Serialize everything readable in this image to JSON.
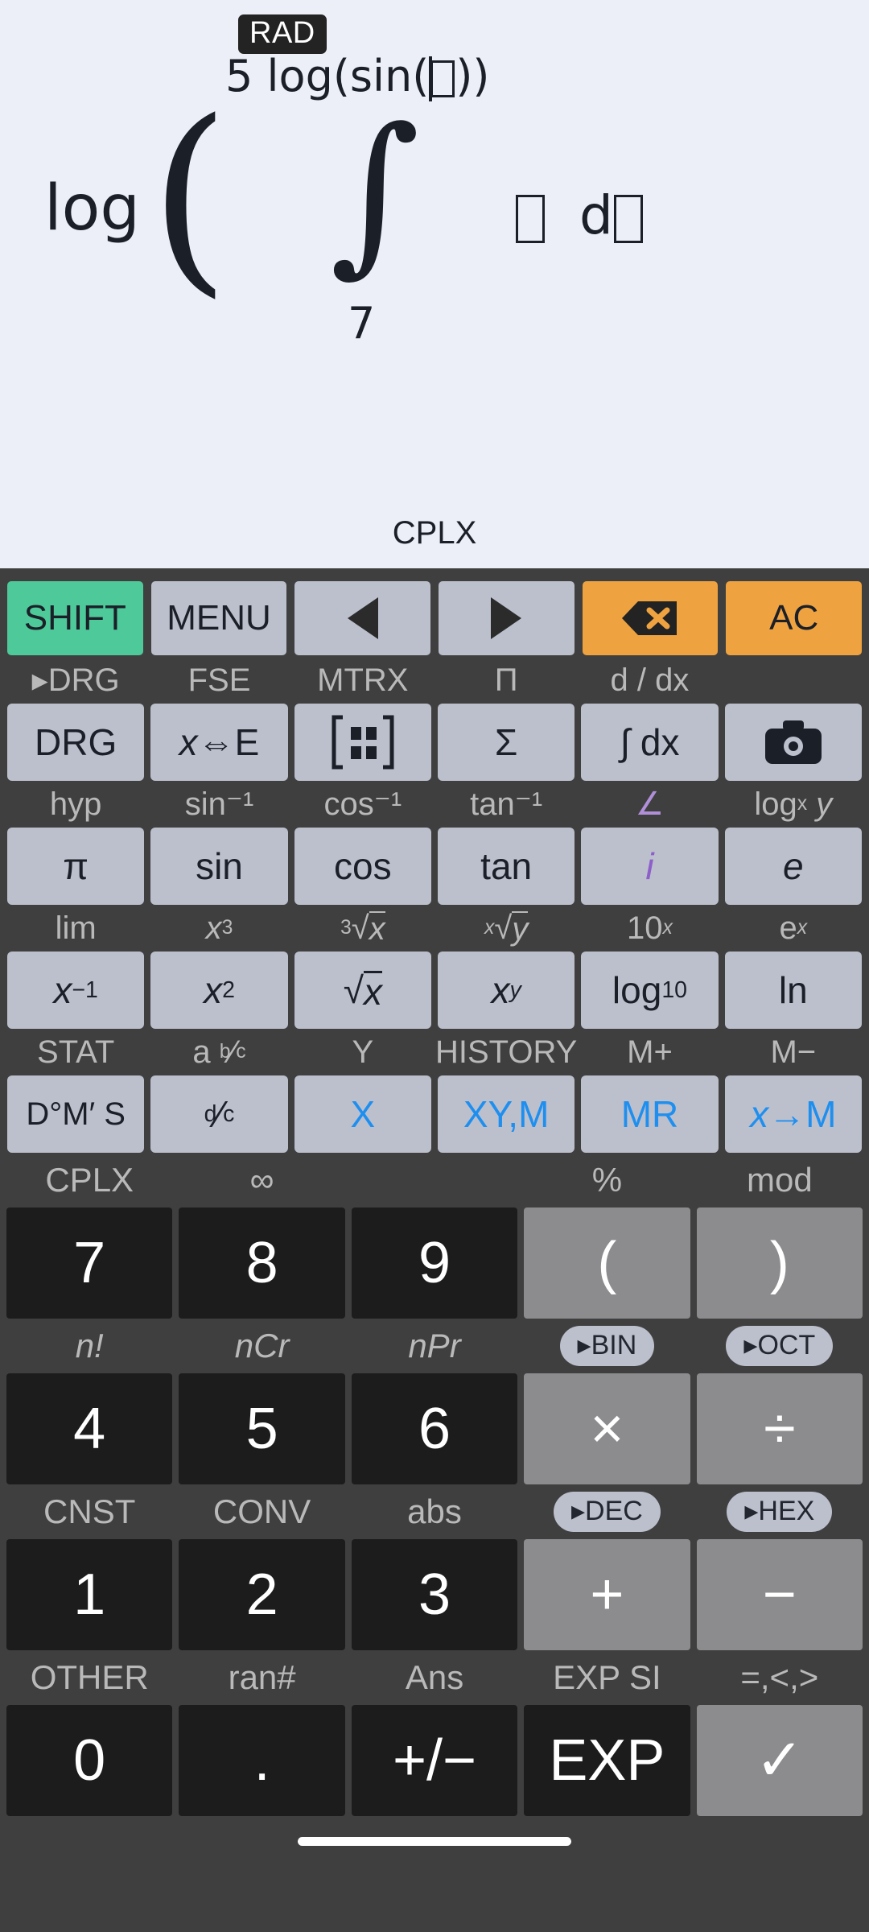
{
  "display": {
    "angle_mode_badge": "RAD",
    "expression": {
      "outer_function": "log",
      "open_paren": "(",
      "integral_upper_limit": "5 log(sin(□))",
      "integral_symbol": "∫",
      "integral_lower_limit": "7",
      "integrand": "□ d□"
    },
    "mode_label": "CPLX"
  },
  "keypad": {
    "control_row": [
      {
        "label": "SHIFT",
        "style": "green",
        "name": "shift-button"
      },
      {
        "label": "MENU",
        "style": "plain",
        "name": "menu-button"
      },
      {
        "label": "◀",
        "style": "plain",
        "name": "cursor-left-button"
      },
      {
        "label": "▶",
        "style": "plain",
        "name": "cursor-right-button"
      },
      {
        "label": "⌫",
        "style": "orange",
        "name": "backspace-button"
      },
      {
        "label": "AC",
        "style": "orange",
        "name": "all-clear-button"
      }
    ],
    "function_rows": [
      {
        "sublabels": [
          "▸DRG",
          "FSE",
          "MTRX",
          "Π",
          "d / dx",
          ""
        ],
        "keys": [
          {
            "label": "DRG",
            "name": "drg-button"
          },
          {
            "label": "x⇔E",
            "name": "x-to-e-button"
          },
          {
            "label": "matrix-icon",
            "name": "matrix-button",
            "icon": "matrix"
          },
          {
            "label": "Σ",
            "name": "sigma-button"
          },
          {
            "label": "∫ dx",
            "name": "integral-dx-button"
          },
          {
            "label": "camera-icon",
            "name": "camera-button",
            "icon": "camera"
          }
        ]
      },
      {
        "sublabels": [
          "hyp",
          "sin⁻¹",
          "cos⁻¹",
          "tan⁻¹",
          "∠",
          "logₓ y"
        ],
        "keys": [
          {
            "label": "π",
            "name": "pi-button"
          },
          {
            "label": "sin",
            "name": "sin-button"
          },
          {
            "label": "cos",
            "name": "cos-button"
          },
          {
            "label": "tan",
            "name": "tan-button"
          },
          {
            "label": "i",
            "name": "imaginary-unit-button",
            "color": "violet"
          },
          {
            "label": "e",
            "name": "euler-e-button"
          }
        ]
      },
      {
        "sublabels": [
          "lim",
          "x³",
          "³√x",
          "ˣ√y",
          "10ˣ",
          "eˣ"
        ],
        "keys": [
          {
            "label": "x⁻¹",
            "name": "reciprocal-button"
          },
          {
            "label": "x²",
            "name": "square-button"
          },
          {
            "label": "√x",
            "name": "square-root-button"
          },
          {
            "label": "xʸ",
            "name": "power-button"
          },
          {
            "label": "log₁₀",
            "name": "log10-button"
          },
          {
            "label": "ln",
            "name": "natural-log-button"
          }
        ]
      },
      {
        "sublabels": [
          "STAT",
          "a b/c",
          "Y",
          "HISTORY",
          "M+",
          "M−"
        ],
        "keys": [
          {
            "label": "D°M′ S",
            "name": "dms-button"
          },
          {
            "label": "d/c",
            "name": "improper-fraction-button"
          },
          {
            "label": "X",
            "name": "variable-x-button",
            "color": "blue"
          },
          {
            "label": "XY,M",
            "name": "xym-button",
            "color": "blue"
          },
          {
            "label": "MR",
            "name": "memory-recall-button",
            "color": "blue"
          },
          {
            "label": "x→M",
            "name": "store-to-memory-button",
            "color": "blue"
          }
        ]
      }
    ],
    "numeric_rows": [
      {
        "sublabels": [
          {
            "text": "CPLX",
            "pill": false
          },
          {
            "text": "∞",
            "pill": false
          },
          {
            "text": "",
            "pill": false
          },
          {
            "text": "%",
            "pill": false
          },
          {
            "text": "mod",
            "pill": false
          }
        ],
        "keys": [
          {
            "label": "7",
            "style": "digit",
            "name": "digit-7-button"
          },
          {
            "label": "8",
            "style": "digit",
            "name": "digit-8-button"
          },
          {
            "label": "9",
            "style": "digit",
            "name": "digit-9-button"
          },
          {
            "label": "(",
            "style": "op",
            "name": "open-paren-button"
          },
          {
            "label": ")",
            "style": "op",
            "name": "close-paren-button"
          }
        ]
      },
      {
        "sublabels": [
          {
            "text": "n!",
            "pill": false
          },
          {
            "text": "nCr",
            "pill": false
          },
          {
            "text": "nPr",
            "pill": false
          },
          {
            "text": "▸BIN",
            "pill": true
          },
          {
            "text": "▸OCT",
            "pill": true
          }
        ],
        "keys": [
          {
            "label": "4",
            "style": "digit",
            "name": "digit-4-button"
          },
          {
            "label": "5",
            "style": "digit",
            "name": "digit-5-button"
          },
          {
            "label": "6",
            "style": "digit",
            "name": "digit-6-button"
          },
          {
            "label": "×",
            "style": "op",
            "name": "multiply-button"
          },
          {
            "label": "÷",
            "style": "op",
            "name": "divide-button"
          }
        ]
      },
      {
        "sublabels": [
          {
            "text": "CNST",
            "pill": false
          },
          {
            "text": "CONV",
            "pill": false
          },
          {
            "text": "abs",
            "pill": false
          },
          {
            "text": "▸DEC",
            "pill": true
          },
          {
            "text": "▸HEX",
            "pill": true
          }
        ],
        "keys": [
          {
            "label": "1",
            "style": "digit",
            "name": "digit-1-button"
          },
          {
            "label": "2",
            "style": "digit",
            "name": "digit-2-button"
          },
          {
            "label": "3",
            "style": "digit",
            "name": "digit-3-button"
          },
          {
            "label": "+",
            "style": "op",
            "name": "plus-button"
          },
          {
            "label": "−",
            "style": "op",
            "name": "minus-button"
          }
        ]
      },
      {
        "sublabels": [
          {
            "text": "OTHER",
            "pill": false
          },
          {
            "text": "ran#",
            "pill": false
          },
          {
            "text": "Ans",
            "pill": false
          },
          {
            "text": "EXP SI",
            "pill": false
          },
          {
            "text": "=,<,>",
            "pill": false
          }
        ],
        "keys": [
          {
            "label": "0",
            "style": "digit",
            "name": "digit-0-button"
          },
          {
            "label": ".",
            "style": "digit",
            "name": "decimal-point-button"
          },
          {
            "label": "+/−",
            "style": "digit",
            "name": "sign-toggle-button"
          },
          {
            "label": "EXP",
            "style": "digit",
            "name": "exponent-button"
          },
          {
            "label": "✓",
            "style": "op",
            "name": "equals-button"
          }
        ]
      }
    ]
  },
  "colors": {
    "display_bg": "#eceff7",
    "keypad_bg": "#3f3f3f",
    "key_light": "#bcc0cd",
    "key_dark": "#1c1c1c",
    "key_op": "#8c8c8f",
    "accent_green": "#4ec99a",
    "accent_orange": "#efa340",
    "accent_blue": "#1f8fef",
    "accent_violet": "#8e5fc9"
  }
}
